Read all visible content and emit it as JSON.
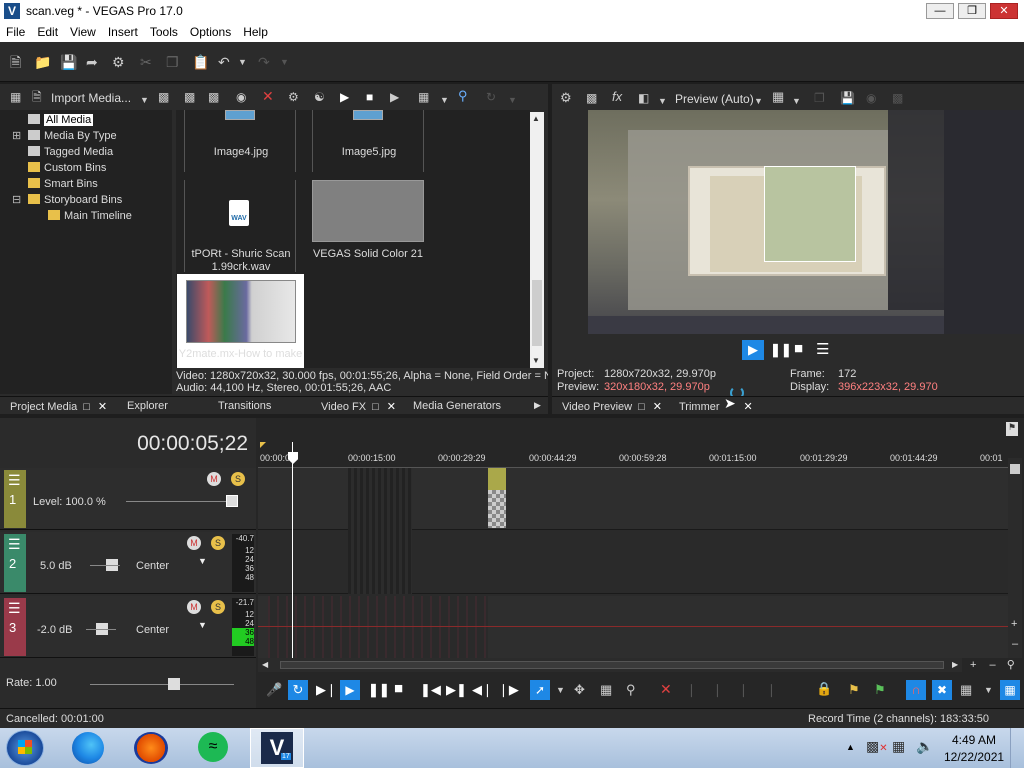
{
  "window": {
    "title": "scan.veg * - VEGAS Pro 17.0",
    "app_badge": "V"
  },
  "menu": [
    "File",
    "Edit",
    "View",
    "Insert",
    "Tools",
    "Options",
    "Help"
  ],
  "media_toolbar": {
    "import_label": "Import Media..."
  },
  "tree": [
    "All Media",
    "Media By Type",
    "Tagged Media",
    "Custom Bins",
    "Smart Bins",
    "Storyboard Bins",
    "Main Timeline"
  ],
  "media_items": [
    {
      "name": "Image4.jpg"
    },
    {
      "name": "Image5.jpg"
    },
    {
      "name": "tPORt - Shuric Scan 1.99crk.wav",
      "line1": "tPORt - Shuric Scan",
      "line2": "1.99crk.wav",
      "badge": "WAV"
    },
    {
      "name": "VEGAS Solid Color 21"
    },
    {
      "name": "Y2mate.mx-How to make"
    }
  ],
  "media_info": {
    "video": "Video: 1280x720x32, 30.000 fps, 00:01:55;26, Alpha = None, Field Order = N",
    "audio": "Audio: 44,100 Hz, Stereo, 00:01:55;26, AAC"
  },
  "left_tabs": [
    "Project Media",
    "Explorer",
    "Transitions",
    "Video FX",
    "Media Generators"
  ],
  "preview": {
    "mode_label": "Preview (Auto)",
    "project_label": "Project:",
    "project_value": "1280x720x32, 29.970p",
    "preview_label": "Preview:",
    "preview_value": "320x180x32, 29.970p",
    "frame_label": "Frame:",
    "frame_value": "172",
    "display_label": "Display:",
    "display_value": "396x223x32, 29.970"
  },
  "right_tabs": [
    "Video Preview",
    "Trimmer"
  ],
  "timeline": {
    "timecode": "00:00:05;22",
    "ruler": [
      "00:00:00",
      "00:00:15:00",
      "00:00:29:29",
      "00:00:44:29",
      "00:00:59:28",
      "00:01:15:00",
      "00:01:29:29",
      "00:01:44:29",
      "00:01"
    ],
    "tracks": [
      {
        "num": "1",
        "level": "Level: 100.0 %",
        "color": "#8a8a3a"
      },
      {
        "num": "2",
        "vol": "5.0 dB",
        "pan": "Center",
        "meter": [
          "-40.7",
          "12",
          "24",
          "36",
          "48"
        ],
        "color": "#3a8a6a"
      },
      {
        "num": "3",
        "vol": "-2.0 dB",
        "pan": "Center",
        "meter": [
          "-21.7",
          "12",
          "24",
          "36",
          "48"
        ],
        "color": "#9a3a4a"
      }
    ],
    "rate": "Rate: 1.00"
  },
  "status": {
    "left": "Cancelled: 00:01:00",
    "right": "Record Time (2 channels): 183:33:50"
  },
  "taskbar": {
    "time": "4:49 AM",
    "date": "12/22/2021",
    "vegas_badge": "V",
    "vegas_ver": "17"
  },
  "colors": {
    "accent_blue": "#1e88e5",
    "audio_meter_green": "#22cc22",
    "highlight_orange": "#ff8080"
  }
}
